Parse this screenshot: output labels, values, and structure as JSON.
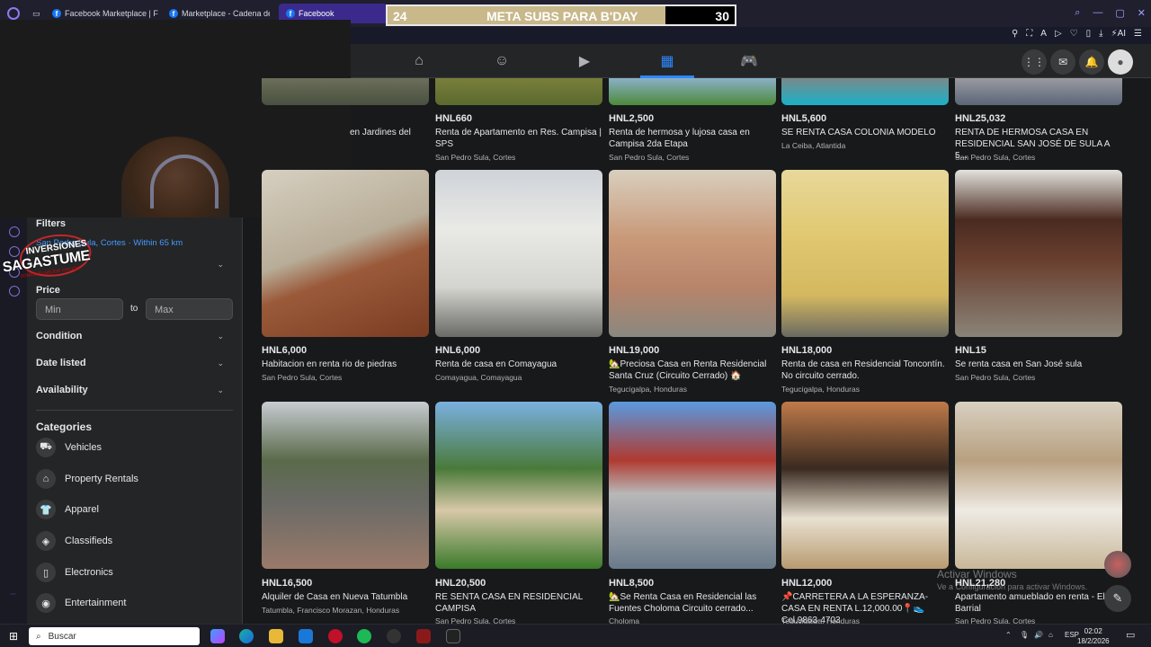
{
  "browser": {
    "tabs": [
      {
        "label": "Facebook Marketplace | Fa"
      },
      {
        "label": "Marketplace - Cadena de"
      },
      {
        "label": "Facebook"
      }
    ]
  },
  "subs_overlay": {
    "current": "24",
    "label": "META SUBS PARA B'DAY",
    "goal": "30",
    "progress": 0.8
  },
  "sidebar": {
    "filters_title": "Filters",
    "location": "San Pedro Sula, Cortes · Within 65 km",
    "price_label": "Price",
    "min_placeholder": "Min",
    "to_label": "to",
    "max_placeholder": "Max",
    "filters": [
      {
        "label": "Condition"
      },
      {
        "label": "Date listed"
      },
      {
        "label": "Availability"
      }
    ],
    "categories_title": "Categories",
    "categories": [
      {
        "label": "Vehicles",
        "icon": "car-icon"
      },
      {
        "label": "Property Rentals",
        "icon": "house-icon"
      },
      {
        "label": "Apparel",
        "icon": "shirt-icon"
      },
      {
        "label": "Classifieds",
        "icon": "tag-icon"
      },
      {
        "label": "Electronics",
        "icon": "phone-icon"
      },
      {
        "label": "Entertainment",
        "icon": "entertainment-icon"
      }
    ]
  },
  "logo": {
    "line1": "INVERSIONES",
    "line2": "SAGASTUME",
    "line3": "SOMOS TU MEJOR OPCIÓN"
  },
  "listings_row1": [
    {
      "price": "",
      "title": "en Jardines del",
      "location": ""
    },
    {
      "price": "HNL660",
      "title": "Renta de Apartamento en Res. Campisa | SPS",
      "location": "San Pedro Sula, Cortes"
    },
    {
      "price": "HNL2,500",
      "title": "Renta de hermosa y lujosa casa en Campisa 2da Etapa",
      "location": "San Pedro Sula, Cortes"
    },
    {
      "price": "HNL5,600",
      "title": "SE RENTA CASA COLONIA MODELO",
      "location": "La Ceiba, Atlantida"
    },
    {
      "price": "HNL25,032",
      "title": "RENTA DE HERMOSA CASA EN RESIDENCIAL SAN JOSÉ DE SULA A 5...",
      "location": "San Pedro Sula, Cortes"
    }
  ],
  "listings_row2": [
    {
      "price": "HNL6,000",
      "title": "Habitacion en renta rio de piedras",
      "location": "San Pedro Sula, Cortes"
    },
    {
      "price": "HNL6,000",
      "title": "Renta de casa en Comayagua",
      "location": "Comayagua, Comayagua"
    },
    {
      "price": "HNL19,000",
      "title": "🏡Preciosa Casa en Renta Residencial Santa Cruz (Circuito Cerrado) 🏠",
      "location": "Tegucigalpa, Honduras"
    },
    {
      "price": "HNL18,000",
      "title": "Renta de casa en Residencial Toncontín. No circuito cerrado.",
      "location": "Tegucigalpa, Honduras"
    },
    {
      "price": "HNL15",
      "title": "Se renta casa en San José sula",
      "location": "San Pedro Sula, Cortes"
    }
  ],
  "listings_row3": [
    {
      "price": "HNL16,500",
      "title": "Alquiler de Casa en Nueva Tatumbla",
      "location": "Tatumbla, Francisco Morazan, Honduras"
    },
    {
      "price": "HNL20,500",
      "title": "RE SENTA CASA EN RESIDENCIAL CAMPISA",
      "location": "San Pedro Sula, Cortes"
    },
    {
      "price": "HNL8,500",
      "title": "🏡Se Renta Casa en Residencial las Fuentes Choloma Circuito cerrado...",
      "location": "Choloma"
    },
    {
      "price": "HNL12,000",
      "title": "📌CARRETERA A LA ESPERANZA-CASA EN RENTA L.12,000.00📍👟 Cel.9863-4703",
      "location": "Tegucigalpa, Honduras"
    },
    {
      "price": "HNL21,280",
      "title": "Apartamento amueblado en renta - El Barrial",
      "location": "San Pedro Sula, Cortes"
    }
  ],
  "watermark": {
    "line1": "Activar Windows",
    "line2": "Ve a Configuración para activar Windows."
  },
  "taskbar": {
    "search_placeholder": "Buscar",
    "language": "ESP",
    "time": "02:02",
    "date": "18/2/2026"
  },
  "colors": {
    "fb_blue": "#2d88ff",
    "background": "#18191a",
    "surface": "#242526"
  }
}
